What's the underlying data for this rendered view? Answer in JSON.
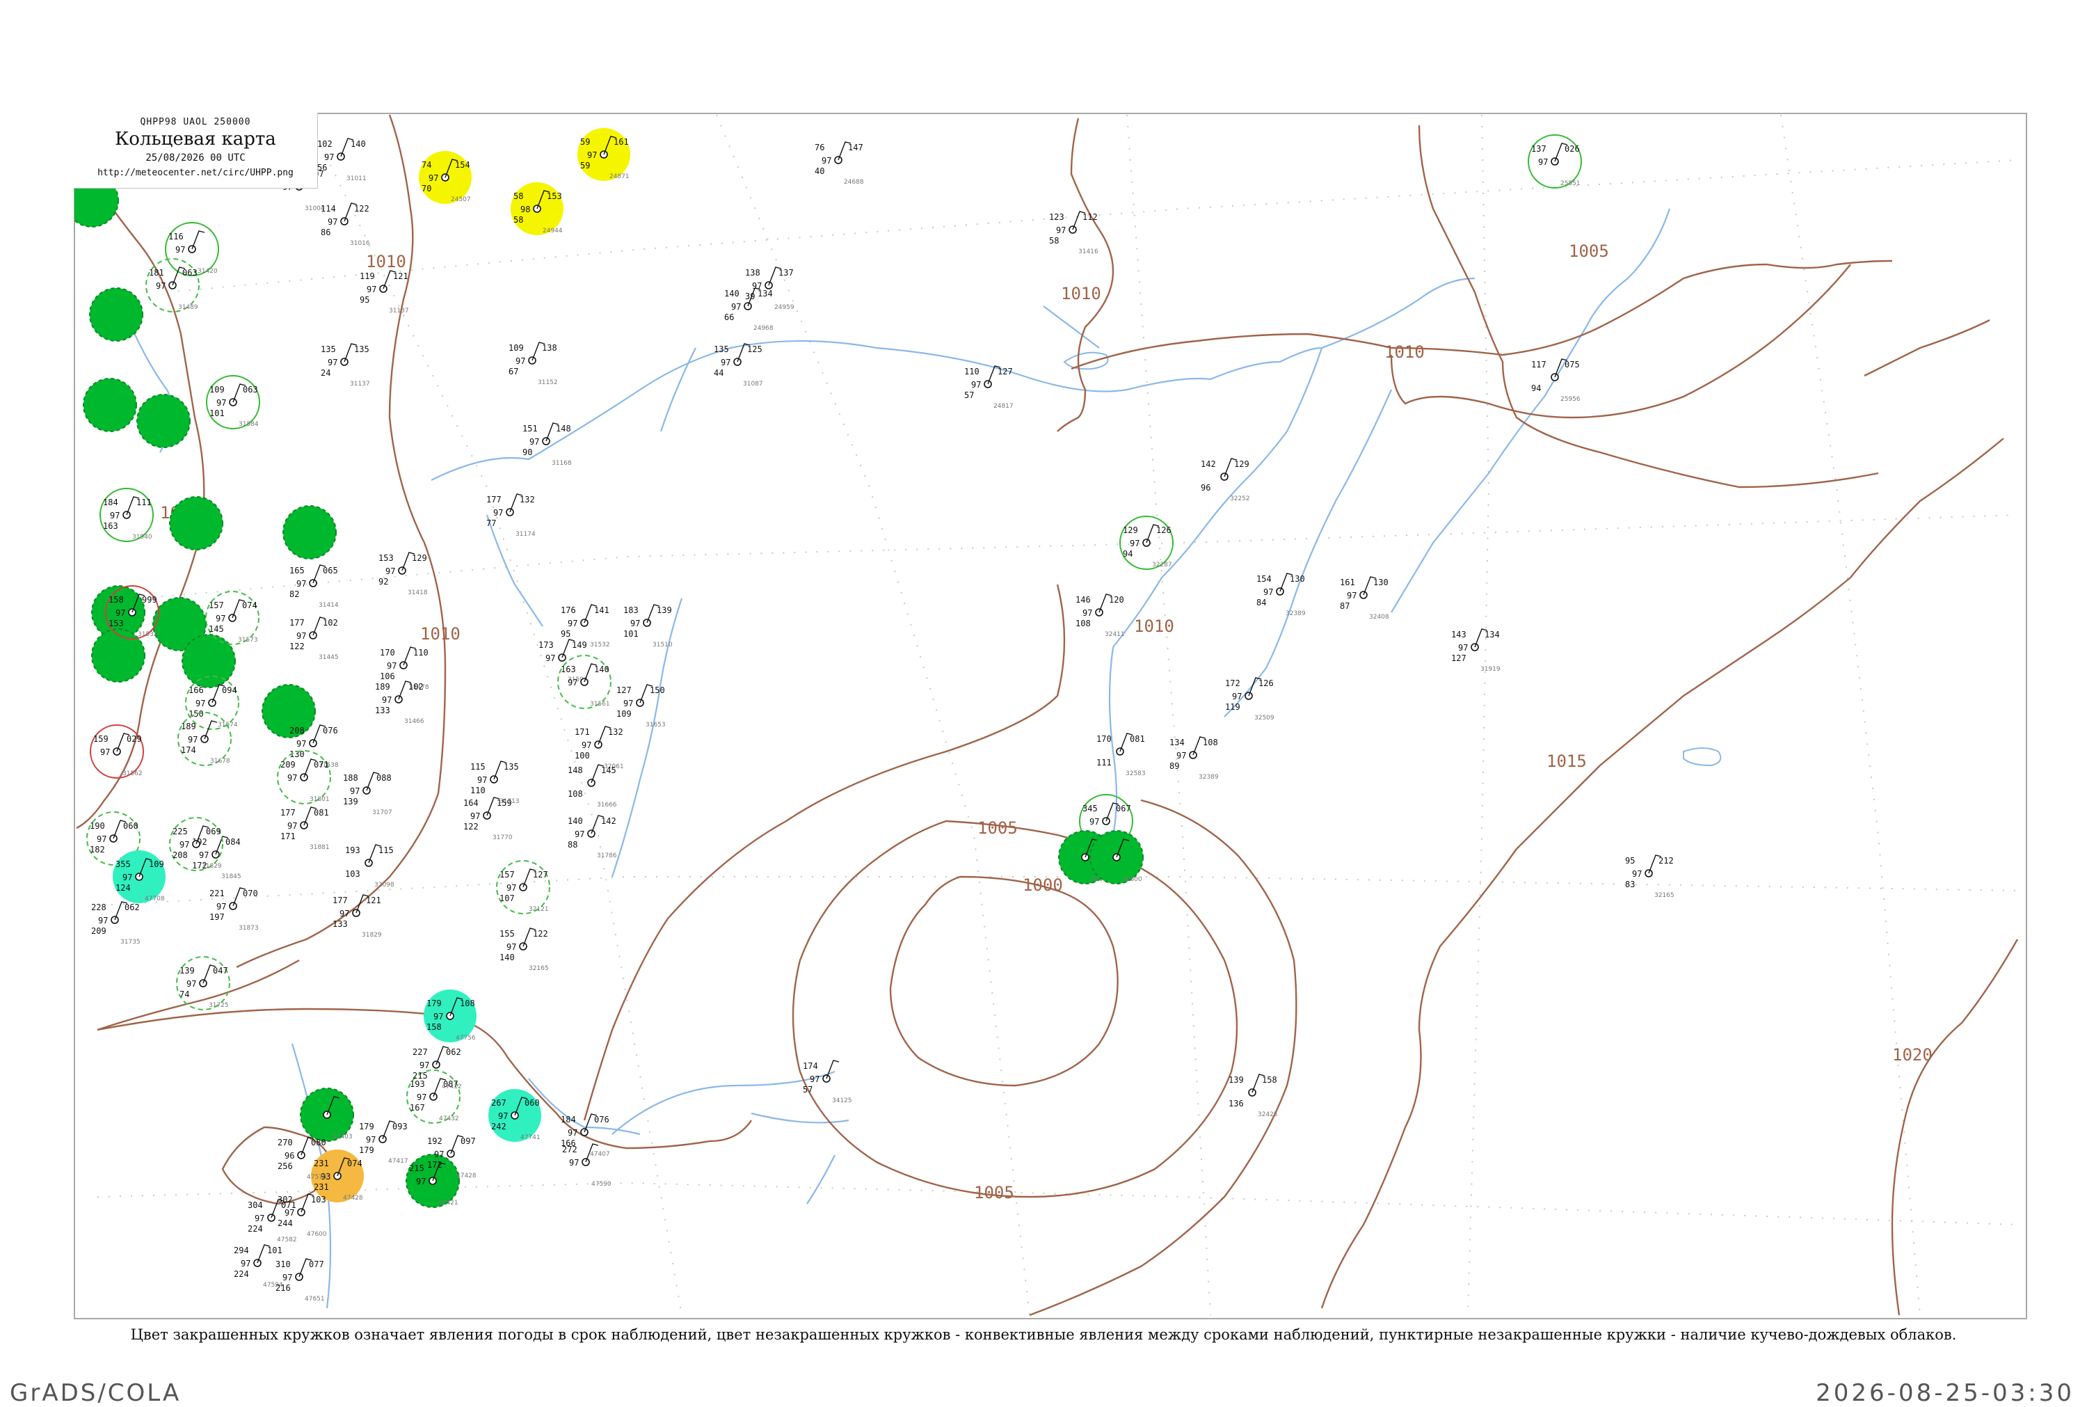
{
  "header": {
    "code": "QHPP98  UAOL  250000",
    "title": "Кольцевая карта",
    "datetime": "25/08/2026 00 UTC",
    "url": "http://meteocenter.net/circ/UHPP.png"
  },
  "caption": "Цвет закрашенных кружков означает явления погоды в срок наблюдений, цвет незакрашенных кружков - конвективные явления между сроками наблюдений, пунктирные незакрашенные кружки - наличие кучево-дождевых облаков.",
  "footer": {
    "left": "GrADS/COLA",
    "right": "2026-08-25-03:30"
  },
  "colors": {
    "isobar": "#a0644a",
    "river": "#8ab8e8",
    "grid": "#c8c8c8",
    "fog_yellow": "#f5f500",
    "rain_green": "#00b82e",
    "shower_cyan": "#30f0c0",
    "thunder_orange": "#f5b840",
    "convective_ring": "#33bb33",
    "cb_ring": "#d04040"
  },
  "isobars": [
    "1010",
    "1010",
    "1005",
    "1010",
    "1010",
    "1010",
    "1015",
    "1005",
    "1000",
    "1005",
    "1020"
  ],
  "stations": [
    {
      "id": "24507",
      "t": "74",
      "p": "154",
      "v": "97",
      "d": "70",
      "fill": "fog_yellow",
      "icon": "fog-icon"
    },
    {
      "id": "24871",
      "t": "59",
      "p": "161",
      "v": "97",
      "d": "59",
      "fill": "fog_yellow",
      "icon": "fog-icon"
    },
    {
      "id": "24944",
      "t": "58",
      "p": "153",
      "v": "98",
      "d": "58",
      "fill": "fog_yellow",
      "icon": "fog-icon"
    },
    {
      "id": "25551",
      "t": "137",
      "p": "026",
      "v": "97",
      "d": "",
      "fill": "",
      "ring": "convective",
      "icon": "cloud-icon"
    },
    {
      "id": "31416",
      "t": "123",
      "p": "112",
      "v": "97",
      "d": "58",
      "fill": "",
      "icon": "cloud-icon"
    },
    {
      "id": "24688",
      "t": "76",
      "p": "147",
      "v": "97",
      "d": "40",
      "fill": "",
      "icon": "cloud-icon"
    },
    {
      "id": "24959",
      "t": "138",
      "p": "137",
      "v": "97",
      "d": "39",
      "fill": "",
      "icon": "cloud-icon"
    },
    {
      "id": "24968",
      "t": "140",
      "p": "134",
      "v": "97",
      "d": "66",
      "fill": "",
      "icon": "cloud-icon"
    },
    {
      "id": "31087",
      "t": "135",
      "p": "125",
      "v": "97",
      "d": "44",
      "fill": "",
      "icon": "cloud-icon"
    },
    {
      "id": "24817",
      "t": "110",
      "p": "127",
      "v": "97",
      "d": "57",
      "fill": "",
      "icon": "cloud-icon"
    },
    {
      "id": "25956",
      "t": "117",
      "p": "075",
      "v": "",
      "d": "94",
      "fill": "",
      "icon": "cloud-icon"
    },
    {
      "id": "31152",
      "t": "109",
      "p": "138",
      "v": "97",
      "d": "67",
      "fill": "",
      "icon": "cloud-icon"
    },
    {
      "id": "31168",
      "t": "151",
      "p": "148",
      "v": "97",
      "d": "90",
      "fill": "",
      "icon": "cloud-icon"
    },
    {
      "id": "31174",
      "t": "177",
      "p": "132",
      "v": "97",
      "d": "77",
      "fill": "",
      "icon": "cloud-icon"
    },
    {
      "id": "32252",
      "t": "142",
      "p": "129",
      "v": "",
      "d": "96",
      "fill": "",
      "icon": "cloud-icon"
    },
    {
      "id": "32287",
      "t": "129",
      "p": "126",
      "v": "97",
      "d": "94",
      "fill": "",
      "ring": "convective",
      "icon": "cloud-icon"
    },
    {
      "id": "32389",
      "t": "154",
      "p": "130",
      "v": "97",
      "d": "84",
      "fill": "",
      "icon": "cloud-icon"
    },
    {
      "id": "32408",
      "t": "161",
      "p": "130",
      "v": "97",
      "d": "87",
      "fill": "",
      "icon": "cloud-icon"
    },
    {
      "id": "31919",
      "t": "143",
      "p": "134",
      "v": "97",
      "d": "127",
      "fill": "",
      "icon": "cloud-icon"
    },
    {
      "id": "32411",
      "t": "146",
      "p": "120",
      "v": "97",
      "d": "108",
      "fill": "",
      "icon": "cloud-icon"
    },
    {
      "id": "32509",
      "t": "172",
      "p": "126",
      "v": "97",
      "d": "119",
      "fill": "",
      "icon": "cloud-icon"
    },
    {
      "id": "32583",
      "t": "170",
      "p": "081",
      "v": "",
      "d": "111",
      "fill": "",
      "icon": "cloud-icon"
    },
    {
      "id": "32389b",
      "t": "134",
      "p": "108",
      "v": "97",
      "d": "89",
      "fill": "",
      "icon": "cloud-icon"
    },
    {
      "id": "32540",
      "t": "345",
      "p": "067",
      "v": "97",
      "d": "",
      "fill": "",
      "ring": "convective",
      "icon": "cloud-icon"
    },
    {
      "id": "32618",
      "t": "",
      "p": "",
      "v": "",
      "d": "",
      "fill": "rain_green",
      "icon": "rain-icon"
    },
    {
      "id": "32600",
      "t": "",
      "p": "",
      "v": "",
      "d": "",
      "fill": "rain_green",
      "icon": "rain-icon"
    },
    {
      "id": "32165",
      "t": "95",
      "p": "212",
      "v": "97",
      "d": "83",
      "fill": "",
      "icon": "cloud-icon"
    },
    {
      "id": "34125",
      "t": "174",
      "p": "",
      "v": "97",
      "d": "57",
      "fill": "",
      "icon": "cloud-icon"
    },
    {
      "id": "32425",
      "t": "139",
      "p": "158",
      "v": "",
      "d": "136",
      "fill": "",
      "icon": "cloud-icon"
    },
    {
      "id": "31510",
      "t": "183",
      "p": "139",
      "v": "97",
      "d": "101",
      "fill": "",
      "icon": "cloud-icon"
    },
    {
      "id": "31532",
      "t": "176",
      "p": "141",
      "v": "97",
      "d": "95",
      "fill": "",
      "icon": "cloud-icon"
    },
    {
      "id": "31594",
      "t": "173",
      "p": "149",
      "v": "97",
      "d": "",
      "fill": "",
      "icon": "cloud-icon"
    },
    {
      "id": "31561",
      "t": "163",
      "p": "140",
      "v": "97",
      "d": "",
      "fill": "",
      "ring": "cb",
      "icon": "cloud-icon"
    },
    {
      "id": "31653",
      "t": "127",
      "p": "150",
      "v": "97",
      "d": "109",
      "fill": "",
      "icon": "cloud-icon"
    },
    {
      "id": "32061",
      "t": "171",
      "p": "132",
      "v": "97",
      "d": "100",
      "fill": "",
      "icon": "cloud-icon"
    },
    {
      "id": "31666",
      "t": "148",
      "p": "145",
      "v": "",
      "d": "108",
      "fill": "",
      "icon": "cloud-icon"
    },
    {
      "id": "31786",
      "t": "140",
      "p": "142",
      "v": "97",
      "d": "88",
      "fill": "",
      "icon": "cloud-icon"
    },
    {
      "id": "31713",
      "t": "115",
      "p": "135",
      "v": "97",
      "d": "110",
      "fill": "",
      "icon": "cloud-icon"
    },
    {
      "id": "31770",
      "t": "164",
      "p": "159",
      "v": "97",
      "d": "122",
      "fill": "",
      "icon": "cloud-icon"
    },
    {
      "id": "32121",
      "t": "157",
      "p": "127",
      "v": "97",
      "d": "107",
      "fill": "",
      "ring": "cb",
      "icon": "cloud-icon"
    },
    {
      "id": "32165b",
      "t": "155",
      "p": "122",
      "v": "97",
      "d": "140",
      "fill": "",
      "icon": "cloud-icon"
    },
    {
      "id": "32098",
      "t": "193",
      "p": "115",
      "v": "",
      "d": "103",
      "fill": "",
      "icon": "cloud-icon"
    },
    {
      "id": "31829",
      "t": "177",
      "p": "121",
      "v": "97",
      "d": "133",
      "fill": "",
      "icon": "cloud-icon"
    },
    {
      "id": "31011",
      "t": "102",
      "p": "140",
      "v": "97",
      "d": "56",
      "fill": "",
      "icon": "cloud-icon"
    },
    {
      "id": "31004",
      "t": "74",
      "p": "097",
      "v": "97",
      "d": "",
      "fill": "",
      "icon": "cloud-icon"
    },
    {
      "id": "31016",
      "t": "114",
      "p": "122",
      "v": "97",
      "d": "86",
      "fill": "",
      "icon": "cloud-icon"
    },
    {
      "id": "31137",
      "t": "119",
      "p": "121",
      "v": "97",
      "d": "95",
      "fill": "",
      "icon": "cloud-icon"
    },
    {
      "id": "31137b",
      "t": "135",
      "p": "135",
      "v": "97",
      "d": "24",
      "fill": "",
      "icon": "cloud-icon"
    },
    {
      "id": "31414",
      "t": "165",
      "p": "065",
      "v": "97",
      "d": "82",
      "fill": "",
      "icon": "cloud-icon"
    },
    {
      "id": "31418",
      "t": "153",
      "p": "129",
      "v": "97",
      "d": "92",
      "fill": "",
      "icon": "cloud-icon"
    },
    {
      "id": "31445",
      "t": "177",
      "p": "102",
      "v": "97",
      "d": "122",
      "fill": "",
      "icon": "cloud-icon"
    },
    {
      "id": "31478",
      "t": "170",
      "p": "110",
      "v": "97",
      "d": "106",
      "fill": "",
      "icon": "cloud-icon"
    },
    {
      "id": "31466",
      "t": "189",
      "p": "102",
      "v": "97",
      "d": "133",
      "fill": "",
      "icon": "cloud-icon"
    },
    {
      "id": "31538",
      "t": "208",
      "p": "076",
      "v": "97",
      "d": "130",
      "fill": "",
      "icon": "cloud-icon"
    },
    {
      "id": "31707",
      "t": "188",
      "p": "088",
      "v": "97",
      "d": "139",
      "fill": "",
      "icon": "cloud-icon"
    },
    {
      "id": "31881",
      "t": "177",
      "p": "081",
      "v": "97",
      "d": "171",
      "fill": "",
      "icon": "cloud-icon"
    },
    {
      "id": "31845",
      "t": "192",
      "p": "084",
      "v": "97",
      "d": "172",
      "fill": "",
      "icon": "cloud-icon"
    },
    {
      "id": "31873",
      "t": "221",
      "p": "070",
      "v": "97",
      "d": "197",
      "fill": "",
      "icon": "cloud-icon"
    },
    {
      "id": "31735",
      "t": "228",
      "p": "062",
      "v": "97",
      "d": "209",
      "fill": "",
      "icon": "cloud-icon"
    },
    {
      "id": "31707b",
      "t": "190",
      "p": "060",
      "v": "97",
      "d": "182",
      "fill": "",
      "ring": "cb",
      "icon": "cloud-icon"
    },
    {
      "id": "31562",
      "t": "159",
      "p": "029",
      "v": "97",
      "d": "",
      "fill": "",
      "ring": "red",
      "icon": "cloud-icon"
    },
    {
      "id": "31532b",
      "t": "158",
      "p": "999",
      "v": "97",
      "d": "153",
      "fill": "",
      "ring": "red",
      "icon": "cloud-icon"
    },
    {
      "id": "31940",
      "t": "184",
      "p": "111",
      "v": "97",
      "d": "163",
      "fill": "",
      "ring": "convective",
      "icon": "cloud-icon"
    },
    {
      "id": "31725",
      "t": "139",
      "p": "047",
      "v": "97",
      "d": "74",
      "fill": "",
      "ring": "cb",
      "icon": "cloud-icon"
    },
    {
      "id": "31584",
      "t": "109",
      "p": "063",
      "v": "97",
      "d": "101",
      "fill": "",
      "ring": "convective",
      "icon": "cloud-icon"
    },
    {
      "id": "31420",
      "t": "116",
      "p": "",
      "v": "97",
      "d": "",
      "fill": "",
      "ring": "convective",
      "icon": "cloud-icon"
    },
    {
      "id": "31489",
      "t": "181",
      "p": "063",
      "v": "97",
      "d": "",
      "fill": "",
      "ring": "cb",
      "icon": "cloud-icon"
    },
    {
      "id": "31573",
      "t": "157",
      "p": "074",
      "v": "97",
      "d": "145",
      "fill": "",
      "ring": "cb",
      "icon": "cloud-icon"
    },
    {
      "id": "31574",
      "t": "166",
      "p": "094",
      "v": "97",
      "d": "150",
      "fill": "",
      "ring": "cb",
      "icon": "cloud-icon"
    },
    {
      "id": "31678",
      "t": "189",
      "p": "",
      "v": "97",
      "d": "174",
      "fill": "",
      "ring": "cb",
      "icon": "cloud-icon"
    },
    {
      "id": "31801",
      "t": "209",
      "p": "071",
      "v": "97",
      "d": "",
      "fill": "",
      "ring": "cb",
      "icon": "cloud-icon"
    },
    {
      "id": "31829b",
      "t": "225",
      "p": "069",
      "v": "97",
      "d": "208",
      "fill": "",
      "ring": "cb",
      "icon": "cloud-icon"
    },
    {
      "id": "47708",
      "t": "355",
      "p": "109",
      "v": "97",
      "d": "124",
      "fill": "shower_cyan",
      "icon": "shower-icon"
    },
    {
      "id": "47756",
      "t": "179",
      "p": "108",
      "v": "97",
      "d": "158",
      "fill": "shower_cyan",
      "icon": "shower-icon"
    },
    {
      "id": "47741",
      "t": "267",
      "p": "060",
      "v": "97",
      "d": "242",
      "fill": "shower_cyan",
      "icon": "shower-icon"
    },
    {
      "id": "47428",
      "t": "231",
      "p": "074",
      "v": "93",
      "d": "231",
      "fill": "thunder_orange",
      "icon": "thunder-icon"
    },
    {
      "id": "47421",
      "t": "215",
      "p": "",
      "v": "97",
      "d": "",
      "fill": "rain_green",
      "icon": "rain-icon"
    },
    {
      "id": "47403",
      "t": "",
      "p": "",
      "v": "",
      "d": "",
      "fill": "rain_green",
      "icon": "rain-icon"
    },
    {
      "id": "47432",
      "t": "193",
      "p": "087",
      "v": "97",
      "d": "167",
      "fill": "",
      "ring": "cb",
      "icon": "cloud-icon"
    },
    {
      "id": "47407",
      "t": "184",
      "p": "076",
      "v": "97",
      "d": "166",
      "fill": "",
      "icon": "cloud-icon"
    },
    {
      "id": "47412",
      "t": "227",
      "p": "062",
      "v": "97",
      "d": "215",
      "fill": "",
      "icon": "cloud-icon"
    },
    {
      "id": "47417",
      "t": "179",
      "p": "093",
      "v": "97",
      "d": "179",
      "fill": "",
      "icon": "cloud-icon"
    },
    {
      "id": "47428b",
      "t": "192",
      "p": "097",
      "v": "97",
      "d": "172",
      "fill": "",
      "icon": "cloud-icon"
    },
    {
      "id": "47590",
      "t": "272",
      "p": "",
      "v": "97",
      "d": "",
      "fill": "",
      "icon": "cloud-icon"
    },
    {
      "id": "47575",
      "t": "270",
      "p": "080",
      "v": "96",
      "d": "256",
      "fill": "",
      "icon": "cloud-icon"
    },
    {
      "id": "47582",
      "t": "304",
      "p": "071",
      "v": "97",
      "d": "224",
      "fill": "",
      "icon": "cloud-icon"
    },
    {
      "id": "47600",
      "t": "302",
      "p": "103",
      "v": "97",
      "d": "244",
      "fill": "",
      "icon": "cloud-icon"
    },
    {
      "id": "47594",
      "t": "294",
      "p": "101",
      "v": "97",
      "d": "224",
      "fill": "",
      "icon": "cloud-icon"
    },
    {
      "id": "47651",
      "t": "310",
      "p": "077",
      "v": "97",
      "d": "216",
      "fill": "",
      "icon": "cloud-icon"
    }
  ]
}
